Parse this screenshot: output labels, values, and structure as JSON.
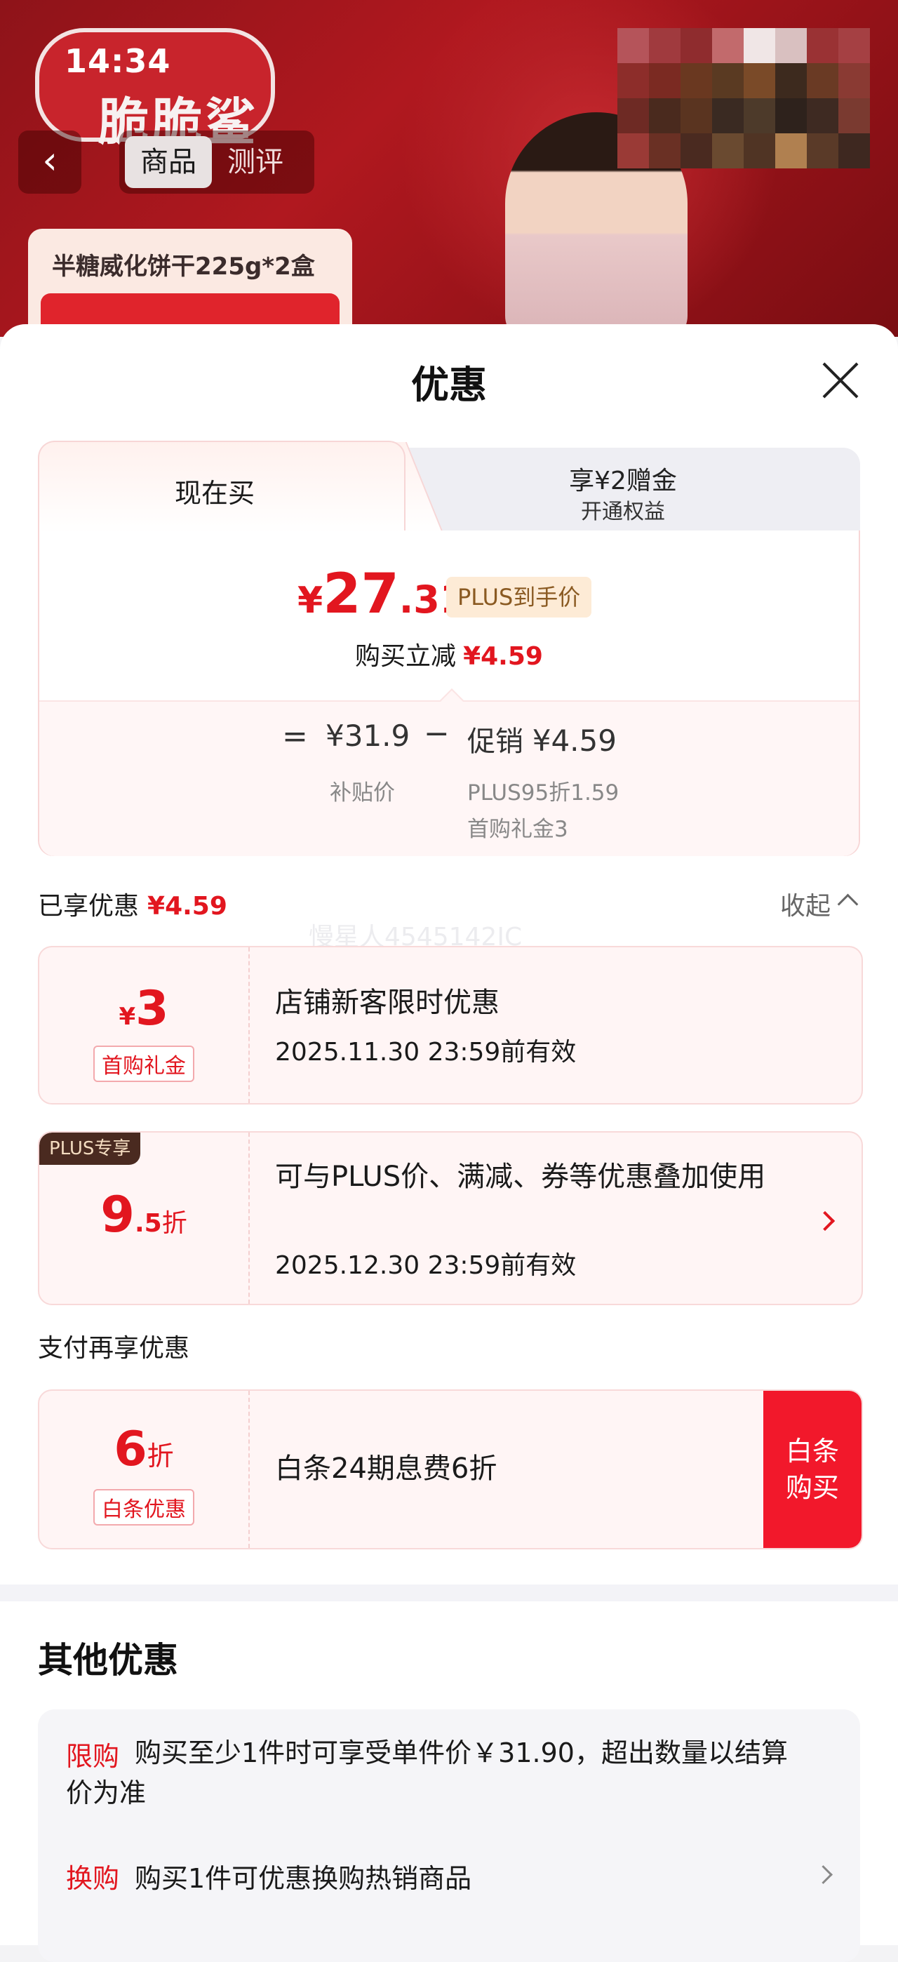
{
  "status_bar": {
    "time": "14:34"
  },
  "background_page": {
    "brand_text": "脆脆鲨",
    "seg_tabs": [
      "商品",
      "测评"
    ],
    "variant_label": "半糖威化饼干225g*2盒",
    "mosaic_colors": [
      "#b5545a",
      "#a03a3e",
      "#8f2c2e",
      "#c26a6c",
      "#f0e6e6",
      "#d9c0c0",
      "#9a3234",
      "#a54043",
      "#8d2d2a",
      "#7b2a22",
      "#6a3820",
      "#5a3a22",
      "#7a4a28",
      "#3d2a1e",
      "#6a3a24",
      "#8a3a33",
      "#6e2a24",
      "#4a2a1e",
      "#5a3420",
      "#3a2a22",
      "#4d3a2a",
      "#2e221c",
      "#3e2a22",
      "#7a3a30",
      "#9a3a36",
      "#6a3024",
      "#4a2a20",
      "#6a4a30",
      "#503424",
      "#b08050",
      "#5a3a28",
      "#3e2820"
    ]
  },
  "sheet": {
    "title": "优惠",
    "tabs": {
      "active": "现在买",
      "inactive_line1": "享¥2赠金",
      "inactive_line2": "开通权益"
    },
    "price": {
      "currency": "¥",
      "integer": "27",
      "decimal": ".31",
      "tag": "PLUS到手价"
    },
    "save": {
      "label": "购买立减",
      "amount": "¥4.59"
    },
    "breakdown": {
      "eq": "=",
      "subsidy_price": "¥31.9",
      "subsidy_label": "补贴价",
      "minus": "−",
      "promo_label": "促销",
      "promo_amount": "¥4.59",
      "detail_1": "PLUS95折1.59",
      "detail_2": "首购礼金3"
    },
    "enjoyed": {
      "label": "已享优惠",
      "amount": "¥4.59",
      "collapse": "收起"
    },
    "watermark": "慢星人4545142IC",
    "coupons": [
      {
        "currency": "¥",
        "value": "3",
        "tag": "首购礼金",
        "title": "店铺新客限时优惠",
        "date": "2025.11.30 23:59前有效"
      },
      {
        "badge": "PLUS专享",
        "value_int": "9",
        "value_dec": ".5",
        "unit": "折",
        "title": "可与PLUS价、满减、券等优惠叠加使用",
        "date": "2025.12.30 23:59前有效"
      }
    ],
    "pay_section": {
      "label": "支付再享优惠",
      "card": {
        "value": "6",
        "unit": "折",
        "tag": "白条优惠",
        "title": "白条24期息费6折",
        "button_line1": "白条",
        "button_line2": "购买"
      }
    },
    "other": {
      "title": "其他优惠",
      "rows": [
        {
          "key": "限购",
          "text_line1": "购买至少1件时可享受单件价￥31.90，超出数量以结算",
          "text_line2": "价为准"
        },
        {
          "key": "换购",
          "text": "购买1件可优惠换购热销商品"
        }
      ]
    }
  }
}
